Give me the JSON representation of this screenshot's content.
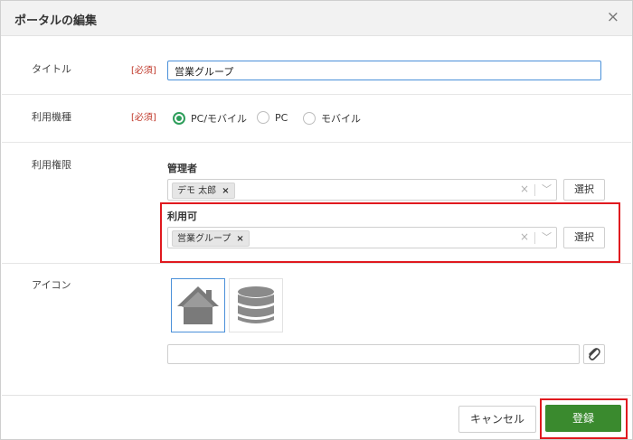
{
  "dialog": {
    "title": "ポータルの編集",
    "close_icon": "×"
  },
  "form": {
    "title_field": {
      "label": "タイトル",
      "required": "[必須]",
      "value": "営業グループ"
    },
    "device_field": {
      "label": "利用機種",
      "required": "[必須]",
      "options": [
        "PC/モバイル",
        "PC",
        "モバイル"
      ],
      "selected": "PC/モバイル"
    },
    "permission_field": {
      "label": "利用権限",
      "admins": {
        "title": "管理者",
        "chips": [
          "デモ 太郎"
        ],
        "select_label": "選択"
      },
      "users": {
        "title": "利用可",
        "chips": [
          "営業グループ"
        ],
        "select_label": "選択"
      }
    },
    "icon_field": {
      "label": "アイコン",
      "icons": [
        "home-icon",
        "database-icon"
      ],
      "selected_icon": "home-icon"
    }
  },
  "footer": {
    "cancel_label": "キャンセル",
    "register_label": "登録"
  },
  "colors": {
    "accent_green": "#3a8a2e",
    "radio_green": "#2e9e5b",
    "highlight_red": "#e0191f",
    "focus_blue": "#4a90d9",
    "required_red": "#c0392b"
  }
}
